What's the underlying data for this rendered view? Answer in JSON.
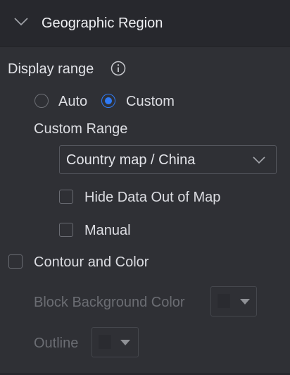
{
  "section": {
    "title": "Geographic Region"
  },
  "display_range": {
    "label": "Display range",
    "options": [
      {
        "label": "Auto",
        "selected": false
      },
      {
        "label": "Custom",
        "selected": true
      }
    ]
  },
  "custom_range": {
    "label": "Custom Range",
    "select_value": "Country map / China",
    "hide_data_out_of_map": {
      "label": "Hide Data Out of Map",
      "checked": false
    },
    "manual": {
      "label": "Manual",
      "checked": false
    }
  },
  "contour_and_color": {
    "label": "Contour and Color",
    "checked": false,
    "block_background_color": {
      "label": "Block Background Color"
    },
    "outline": {
      "label": "Outline"
    }
  },
  "colors": {
    "accent": "#2f7af5",
    "panel_bg": "#2f3035",
    "header_bg": "#27282d"
  }
}
